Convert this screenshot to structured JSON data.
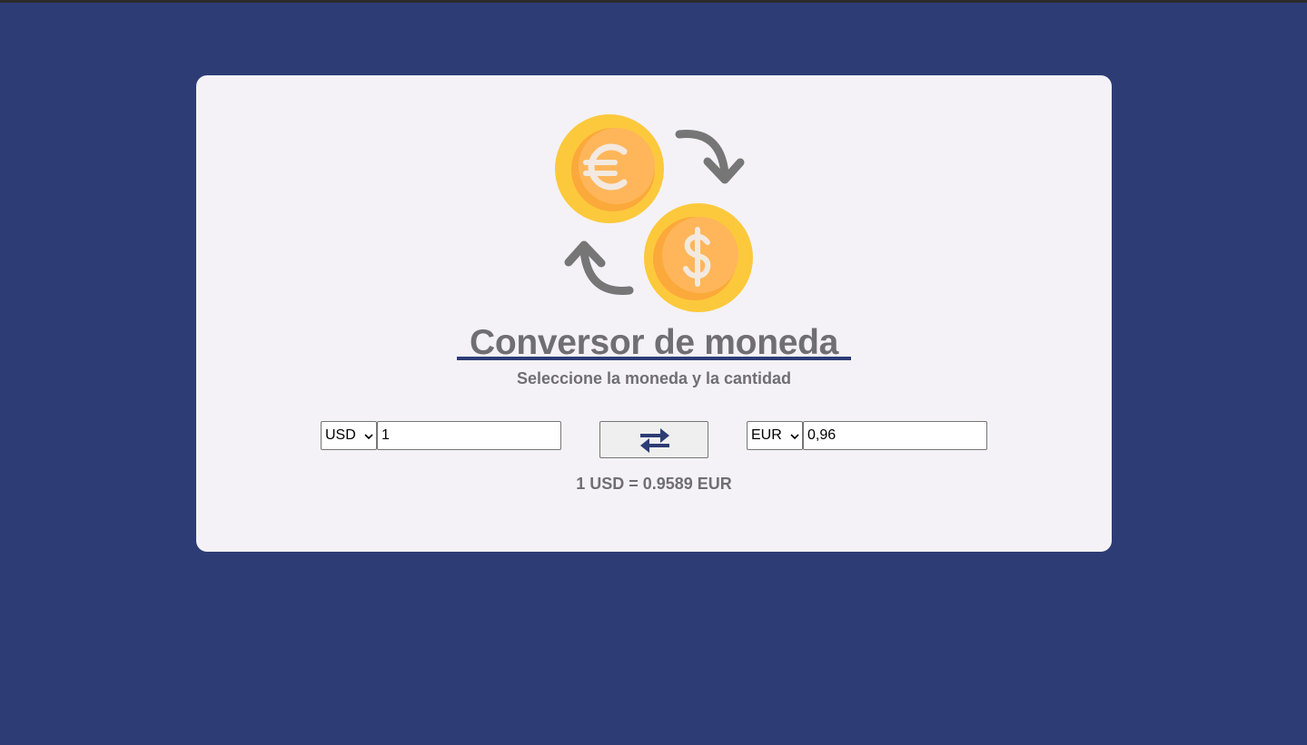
{
  "app": {
    "title": "Conversor de moneda",
    "subtitle": "Seleccione la moneda y la cantidad"
  },
  "colors": {
    "background": "#2d3c75",
    "card": "#f4f2f7",
    "text": "#6f6f73",
    "accent": "#2d3c75",
    "coin": "#fcc93c",
    "arrow": "#767676"
  },
  "converter": {
    "from_currency": "USD",
    "from_amount": "1",
    "to_currency": "EUR",
    "to_amount": "0,96",
    "swap_icon": "swap-arrows-icon"
  },
  "rate_text": "1 USD = 0.9589 EUR",
  "logo": {
    "icon": "currency-exchange-icon",
    "coins": [
      "euro-coin",
      "dollar-coin"
    ]
  }
}
